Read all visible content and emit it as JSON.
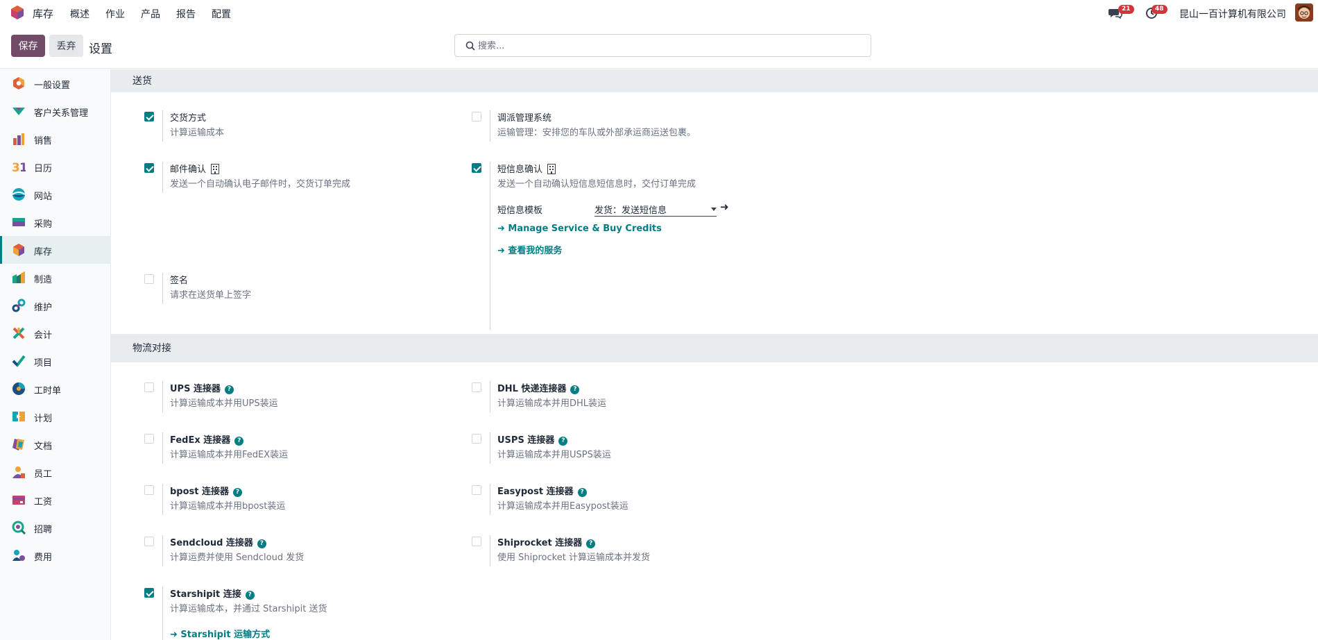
{
  "navbar": {
    "app_name": "库存",
    "menu": [
      "概述",
      "作业",
      "产品",
      "报告",
      "配置"
    ],
    "messages_count": "21",
    "activities_count": "48",
    "company": "昆山一百计算机有限公司",
    "logo_icon": "inventory-app-icon",
    "avatar_icon": "user-avatar"
  },
  "controlbar": {
    "save_label": "保存",
    "discard_label": "丢弃",
    "breadcrumb": "设置",
    "search_placeholder": "搜索..."
  },
  "sidebar": {
    "items": [
      {
        "label": "一般设置",
        "icon": "general-settings-icon"
      },
      {
        "label": "客户关系管理",
        "icon": "crm-icon"
      },
      {
        "label": "销售",
        "icon": "sales-icon"
      },
      {
        "label": "日历",
        "icon": "calendar-icon"
      },
      {
        "label": "网站",
        "icon": "website-icon"
      },
      {
        "label": "采购",
        "icon": "purchase-icon"
      },
      {
        "label": "库存",
        "icon": "inventory-icon"
      },
      {
        "label": "制造",
        "icon": "manufacturing-icon"
      },
      {
        "label": "维护",
        "icon": "maintenance-icon"
      },
      {
        "label": "会计",
        "icon": "accounting-icon"
      },
      {
        "label": "项目",
        "icon": "project-icon"
      },
      {
        "label": "工时单",
        "icon": "timesheet-icon"
      },
      {
        "label": "计划",
        "icon": "planning-icon"
      },
      {
        "label": "文档",
        "icon": "documents-icon"
      },
      {
        "label": "员工",
        "icon": "employees-icon"
      },
      {
        "label": "工资",
        "icon": "payroll-icon"
      },
      {
        "label": "招聘",
        "icon": "recruitment-icon"
      },
      {
        "label": "费用",
        "icon": "expenses-icon"
      }
    ],
    "active": "库存"
  },
  "shipping": {
    "heading": "送货",
    "delivery_methods": {
      "title": "交货方式",
      "desc": "计算运输成本",
      "checked": true
    },
    "dispatch": {
      "title": "调派管理系统",
      "desc": "运输管理：安排您的车队或外部承运商运送包裹。",
      "checked": false
    },
    "email_confirm": {
      "title": "邮件确认",
      "desc": "发送一个自动确认电子邮件时，交货订单完成",
      "checked": true
    },
    "sms_confirm": {
      "title": "短信息确认",
      "desc": "发送一个自动确认短信息短信息时，交付订单完成",
      "checked": true
    },
    "sms_template_label": "短信息模板",
    "sms_template_value": "发货：发送短信息",
    "manage_service_link": "Manage Service & Buy Credits",
    "my_services_link": "查看我的服务",
    "signature": {
      "title": "签名",
      "desc": "请求在送货单上签字",
      "checked": false
    }
  },
  "connectors": {
    "heading": "物流对接",
    "ups": {
      "title": "UPS 连接器",
      "desc": "计算运输成本并用UPS装运",
      "checked": false
    },
    "dhl": {
      "title": "DHL 快递连接器",
      "desc": "计算运输成本并用DHL装运",
      "checked": false
    },
    "fedex": {
      "title": "FedEx 连接器",
      "desc": "计算运输成本并用FedEX装运",
      "checked": false
    },
    "usps": {
      "title": "USPS 连接器",
      "desc": "计算运输成本并用USPS装运",
      "checked": false
    },
    "bpost": {
      "title": "bpost 连接器",
      "desc": "计算运输成本并用bpost装运",
      "checked": false
    },
    "easypost": {
      "title": "Easypost 连接器",
      "desc": "计算运输成本并用Easypost装运",
      "checked": false
    },
    "sendcloud": {
      "title": "Sendcloud 连接器",
      "desc": "计算运费并使用 Sendcloud 发货",
      "checked": false
    },
    "shiprocket": {
      "title": "Shiprocket 连接器",
      "desc": "使用 Shiprocket 计算运输成本并发货",
      "checked": false
    },
    "starshipit": {
      "title": "Starshipit 连接",
      "desc": "计算运输成本，并通过 Starshipit 送货",
      "checked": true
    },
    "starshipit_link": "Starshipit 运输方式"
  },
  "colors": {
    "brand": "#714b67",
    "accent": "#017e84",
    "badge": "#d4343d"
  }
}
